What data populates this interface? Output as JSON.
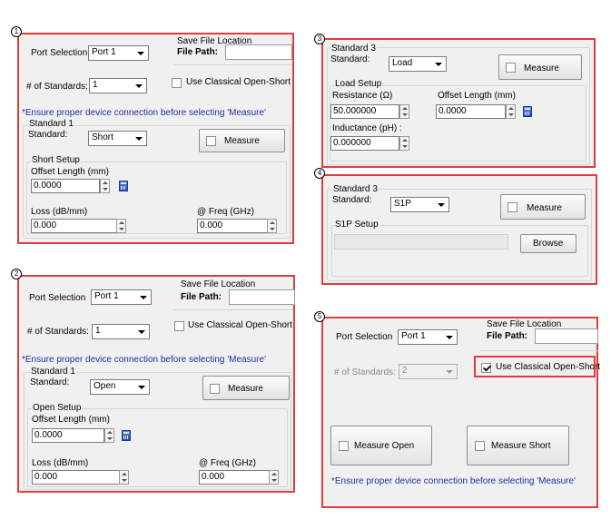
{
  "markers": [
    "1",
    "2",
    "3",
    "4",
    "5"
  ],
  "colors": {
    "highlight_border": "#e03c3c",
    "note_text": "#1f2fa8",
    "panel_bg": "#f0f0f0"
  },
  "panel1": {
    "port_selection_label": "Port Selection",
    "port_value": "Port 1",
    "save_file_location_label": "Save File Location",
    "file_path_label": "File Path:",
    "num_standards_label": "# of Standards:",
    "num_standards_value": "1",
    "classical_label": "Use Classical Open-Short",
    "classical_checked": false,
    "note": "*Ensure proper device connection before selecting 'Measure'",
    "standard_group": "Standard 1",
    "standard_label": "Standard:",
    "standard_value": "Short",
    "measure_label": "Measure",
    "setup_group": "Short Setup",
    "offset_length_label": "Offset Length (mm)",
    "offset_length_value": "0.0000",
    "loss_label": "Loss (dB/mm)",
    "loss_value": "0.000",
    "freq_label": "@ Freq (GHz)",
    "freq_value": "0.000",
    "calculator_icon": "calculator-icon"
  },
  "panel2": {
    "port_selection_label": "Port Selection",
    "port_value": "Port 1",
    "save_file_location_label": "Save File Location",
    "file_path_label": "File Path:",
    "num_standards_label": "# of Standards:",
    "num_standards_value": "1",
    "classical_label": "Use Classical Open-Short",
    "classical_checked": false,
    "note": "*Ensure proper device connection before selecting 'Measure'",
    "standard_group": "Standard 1",
    "standard_label": "Standard:",
    "standard_value": "Open",
    "measure_label": "Measure",
    "setup_group": "Open Setup",
    "offset_length_label": "Offset Length (mm)",
    "offset_length_value": "0.0000",
    "loss_label": "Loss (dB/mm)",
    "loss_value": "0.000",
    "freq_label": "@ Freq (GHz)",
    "freq_value": "0.000"
  },
  "panel3": {
    "standard_group": "Standard 3",
    "standard_label": "Standard:",
    "standard_value": "Load",
    "measure_label": "Measure",
    "setup_group": "Load Setup",
    "resistance_label": "Resistance (Ω)",
    "resistance_value": "50.000000",
    "offset_length_label": "Offset Length (mm)",
    "offset_length_value": "0.0000",
    "inductance_label": "Inductance (pH) :",
    "inductance_value": "0.000000"
  },
  "panel4": {
    "standard_group": "Standard 3",
    "standard_label": "Standard:",
    "standard_value": "S1P",
    "measure_label": "Measure",
    "setup_group": "S1P Setup",
    "browse_label": "Browse"
  },
  "panel5": {
    "port_selection_label": "Port Selection",
    "port_value": "Port 1",
    "save_file_location_label": "Save File Location",
    "file_path_label": "File Path:",
    "num_standards_label": "# of Standards:",
    "num_standards_value": "2",
    "classical_label": "Use Classical Open-Short",
    "classical_checked": true,
    "measure_open_label": "Measure Open",
    "measure_short_label": "Measure Short",
    "note": "*Ensure proper device connection before selecting 'Measure'"
  }
}
